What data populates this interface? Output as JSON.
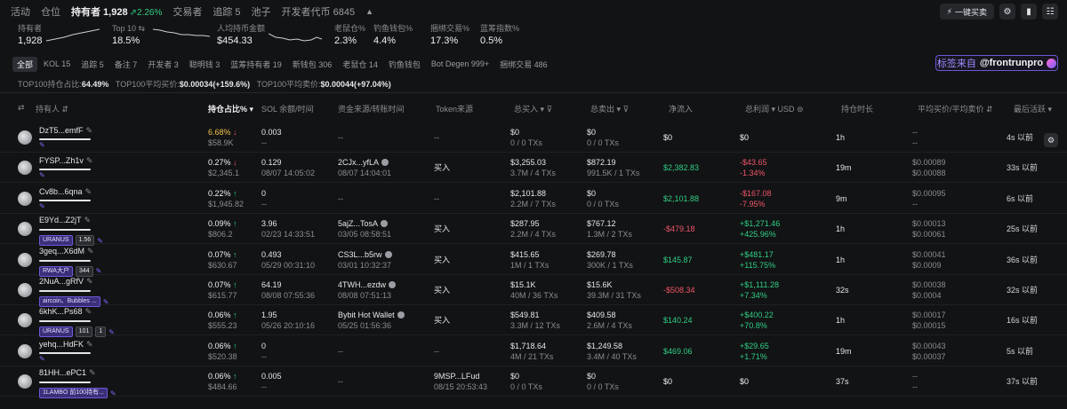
{
  "tabs": [
    {
      "label": "活动",
      "active": false
    },
    {
      "label": "仓位",
      "active": false
    },
    {
      "label": "持有者 1,928",
      "active": true,
      "extra": "2.26%"
    },
    {
      "label": "交易者",
      "active": false
    },
    {
      "label": "追踪 5",
      "active": false
    },
    {
      "label": "池子",
      "active": false
    },
    {
      "label": "开发者代币 6845",
      "active": false
    }
  ],
  "topright": {
    "sell_label": "一键买卖"
  },
  "stats": [
    {
      "label": "持有者",
      "value": "1,928"
    },
    {
      "label": "Top 10 ⇆",
      "value": "18.5%"
    },
    {
      "label": "人均持币金额",
      "value": "$454.33"
    },
    {
      "label": "老鼠仓%",
      "value": "2.3%"
    },
    {
      "label": "钓鱼钱包%",
      "value": "4.4%"
    },
    {
      "label": "捆绑交易%",
      "value": "17.3%"
    },
    {
      "label": "蓝筹指数%",
      "value": "0.5%"
    }
  ],
  "chips": [
    {
      "label": "全部",
      "active": true
    },
    {
      "label": "KOL 15"
    },
    {
      "label": "追踪 5"
    },
    {
      "label": "备注 7"
    },
    {
      "label": "开发者 3"
    },
    {
      "label": "聪明钱 3"
    },
    {
      "label": "蓝筹持有者 19"
    },
    {
      "label": "新钱包 306"
    },
    {
      "label": "老鼠仓 14"
    },
    {
      "label": "钓鱼钱包"
    },
    {
      "label": "Bot Degen 999+"
    },
    {
      "label": "捆绑交易 486"
    }
  ],
  "tag_source": {
    "prefix": "标签来自",
    "handle": "@frontrunpro"
  },
  "summary": {
    "l1": "TOP100持仓占比:",
    "v1": "64.49%",
    "l2": "TOP100平均买价:",
    "v2": "$0.00034",
    "c2": "(+159.6%)",
    "l3": "TOP100平均卖价:",
    "v3": "$0.00044",
    "c3": "(+97.04%)"
  },
  "columns": {
    "holder": "持有人 ⇵",
    "pct": "持仓占比% ▾",
    "sol": "SOL 余额/时间",
    "fund": "资金来源/转账时间",
    "token_src": "Token来源",
    "bought": "总买入 ▾ ⊽",
    "sold": "总卖出 ▾ ⊽",
    "net": "净流入",
    "pnl": "总利润 ▾  USD ⊜",
    "hold": "持仓时长",
    "avg": "平均买价/平均卖价 ⇵",
    "last": "最后活跃 ▾"
  },
  "rows": [
    {
      "name": "DzT5...emfF",
      "pct": "6.68%",
      "pct_dir": "↓",
      "pct_color": "yellow",
      "usd": "$58.9K",
      "sol": "0.003",
      "sol_time": "--",
      "fund": "--",
      "fund_time": "",
      "src": "--",
      "bought": "$0",
      "bought_tx": "0 / 0 TXs",
      "sold": "$0",
      "sold_tx": "0 / 0 TXs",
      "net": "$0",
      "net_color": "white",
      "pnl": "$0",
      "pnl_pct": "",
      "pnl_color": "white",
      "hold": "1h",
      "avg_buy": "--",
      "avg_sell": "--",
      "last": "4s 以前",
      "badges": []
    },
    {
      "name": "FYSP...Zh1v",
      "pct": "0.27%",
      "pct_dir": "↓",
      "pct_color": "white",
      "usd": "$2,345.1",
      "sol": "0.129",
      "sol_time": "08/07 14:05:02",
      "fund": "2CJx...yfLA",
      "fund_time": "08/07 14:04:01",
      "src": "买入",
      "bought": "$3,255.03",
      "bought_tx": "3.7M / 4 TXs",
      "sold": "$872.19",
      "sold_tx": "991.5K / 1 TXs",
      "net": "$2,382.83",
      "net_color": "green",
      "pnl": "-$43.65",
      "pnl_pct": "-1.34%",
      "pnl_color": "red",
      "hold": "19m",
      "avg_buy": "$0.00089",
      "avg_sell": "$0.00088",
      "last": "33s 以前",
      "badges": []
    },
    {
      "name": "Cv8b...6qna",
      "pct": "0.22%",
      "pct_dir": "↑",
      "pct_color": "white",
      "usd": "$1,945.82",
      "sol": "0",
      "sol_time": "--",
      "fund": "--",
      "fund_time": "",
      "src": "--",
      "bought": "$2,101.88",
      "bought_tx": "2.2M / 7 TXs",
      "sold": "$0",
      "sold_tx": "0 / 0 TXs",
      "net": "$2,101.88",
      "net_color": "green",
      "pnl": "-$167.08",
      "pnl_pct": "-7.95%",
      "pnl_color": "red",
      "hold": "9m",
      "avg_buy": "$0.00095",
      "avg_sell": "--",
      "last": "6s 以前",
      "badges": []
    },
    {
      "name": "E9Yd...Z2jT",
      "pct": "0.09%",
      "pct_dir": "↑",
      "pct_color": "white",
      "usd": "$806.2",
      "sol": "3.96",
      "sol_time": "02/23 14:33:51",
      "fund": "5ajZ...TosA",
      "fund_time": "03/05 08:58:51",
      "src": "买入",
      "bought": "$287.95",
      "bought_tx": "2.2M / 4 TXs",
      "sold": "$767.12",
      "sold_tx": "1.3M / 2 TXs",
      "net": "-$479.18",
      "net_color": "red",
      "pnl": "+$1,271.46",
      "pnl_pct": "+425.96%",
      "pnl_color": "green",
      "hold": "1h",
      "avg_buy": "$0.00013",
      "avg_sell": "$0.00061",
      "last": "25s 以前",
      "badges": [
        "URANUS",
        "1.56"
      ]
    },
    {
      "name": "3geq...X6dM",
      "pct": "0.07%",
      "pct_dir": "↑",
      "pct_color": "white",
      "usd": "$630.67",
      "sol": "0.493",
      "sol_time": "05/29 00:31:10",
      "fund": "CS3L...b5rw",
      "fund_time": "03/01 10:32:37",
      "src": "买入",
      "bought": "$415.65",
      "bought_tx": "1M / 1 TXs",
      "sold": "$269.78",
      "sold_tx": "300K / 1 TXs",
      "net": "$145.87",
      "net_color": "green",
      "pnl": "+$481.17",
      "pnl_pct": "+115.75%",
      "pnl_color": "green",
      "hold": "1h",
      "avg_buy": "$0.00041",
      "avg_sell": "$0.0009",
      "last": "36s 以前",
      "badges": [
        "RWA大户",
        "344"
      ]
    },
    {
      "name": "2NuA...gRfV",
      "pct": "0.07%",
      "pct_dir": "↑",
      "pct_color": "white",
      "usd": "$615.77",
      "sol": "64.19",
      "sol_time": "08/08 07:55:36",
      "fund": "4TWH...ezdw",
      "fund_time": "08/08 07:51:13",
      "src": "买入",
      "bought": "$15.1K",
      "bought_tx": "40M / 36 TXs",
      "sold": "$15.6K",
      "sold_tx": "39.3M / 31 TXs",
      "net": "-$508.34",
      "net_color": "red",
      "pnl": "+$1,111.28",
      "pnl_pct": "+7.34%",
      "pnl_color": "green",
      "hold": "32s",
      "avg_buy": "$0.00038",
      "avg_sell": "$0.0004",
      "last": "32s 以前",
      "badges": [
        "aircoin、Bubbles ..."
      ]
    },
    {
      "name": "6khK...Ps68",
      "pct": "0.06%",
      "pct_dir": "↑",
      "pct_color": "white",
      "usd": "$555.23",
      "sol": "1.95",
      "sol_time": "05/26 20:10:16",
      "fund": "Bybit Hot Wallet",
      "fund_time": "05/25 01:56:36",
      "src": "买入",
      "bought": "$549.81",
      "bought_tx": "3.3M / 12 TXs",
      "sold": "$409.58",
      "sold_tx": "2.6M / 4 TXs",
      "net": "$140.24",
      "net_color": "green",
      "pnl": "+$400.22",
      "pnl_pct": "+70.8%",
      "pnl_color": "green",
      "hold": "1h",
      "avg_buy": "$0.00017",
      "avg_sell": "$0.00015",
      "last": "16s 以前",
      "badges": [
        "URANUS",
        "101",
        "1"
      ]
    },
    {
      "name": "yehq...HdFK",
      "pct": "0.06%",
      "pct_dir": "↑",
      "pct_color": "white",
      "usd": "$520.38",
      "sol": "0",
      "sol_time": "--",
      "fund": "--",
      "fund_time": "",
      "src": "--",
      "bought": "$1,718.64",
      "bought_tx": "4M / 21 TXs",
      "sold": "$1,249.58",
      "sold_tx": "3.4M / 40 TXs",
      "net": "$469.06",
      "net_color": "green",
      "pnl": "+$29.65",
      "pnl_pct": "+1.71%",
      "pnl_color": "green",
      "hold": "19m",
      "avg_buy": "$0.00043",
      "avg_sell": "$0.00037",
      "last": "5s 以前",
      "badges": []
    },
    {
      "name": "81HH...ePC1",
      "pct": "0.06%",
      "pct_dir": "↑",
      "pct_color": "white",
      "usd": "$484.66",
      "sol": "0.005",
      "sol_time": "--",
      "fund": "--",
      "fund_time": "",
      "src": "9MSP...LFud",
      "src_time": "08/15 20:53:43",
      "bought": "$0",
      "bought_tx": "0 / 0 TXs",
      "sold": "$0",
      "sold_tx": "0 / 0 TXs",
      "net": "$0",
      "net_color": "white",
      "pnl": "$0",
      "pnl_pct": "",
      "pnl_color": "white",
      "hold": "37s",
      "avg_buy": "--",
      "avg_sell": "--",
      "last": "37s 以前",
      "badges": [
        "1LAMBO 前100持有..."
      ]
    }
  ]
}
